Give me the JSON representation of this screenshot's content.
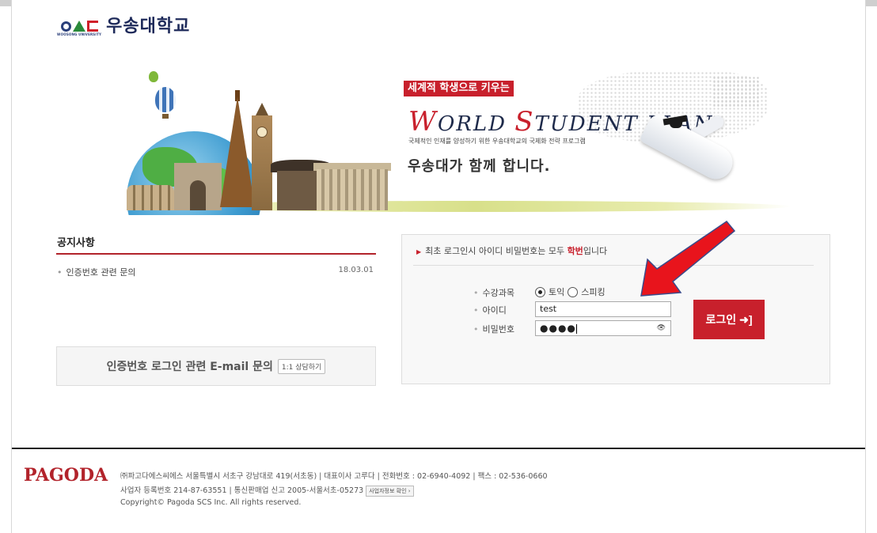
{
  "logo": {
    "text": "우송대학교",
    "sub": "WOOSONG UNIVERSITY"
  },
  "banner": {
    "slogan": "세계적 학생으로 키우는",
    "title_parts": [
      "W",
      "ORLD ",
      "S",
      "TUDENT ",
      "PLAN"
    ],
    "subtitle": "국제적인 인재를 양성하기 위한 우송대학교의 국제화 전략 프로그램",
    "together": "우송대가 함께 합니다."
  },
  "notice": {
    "title": "공지사항",
    "items": [
      {
        "label": "인증번호 관련 문의",
        "date": "18.03.01"
      }
    ]
  },
  "inquiry": {
    "text": "인증번호 로그인 관련 E-mail 문의",
    "button": "1:1 상담하기"
  },
  "login": {
    "notice_prefix": "최초 로그인시 아이디 비밀번호는 모두 ",
    "notice_emph": "학번",
    "notice_suffix": "입니다",
    "course_label": "수강과목",
    "course_options": [
      "토익",
      "스피킹"
    ],
    "id_label": "아이디",
    "id_value": "test",
    "pw_label": "비밀번호",
    "pw_value": "●●●●",
    "button": "로그인"
  },
  "footer": {
    "brand": "PAGODA",
    "line1": "㈜파고다에스씨에스 서울특별시 서초구 강남대로 419(서초동)  |  대표이사 고루다  |  전화번호 : 02-6940-4092  |  팩스 : 02-536-0660",
    "line2": "사업자 등록번호 214-87-63551  |  통신판매업 신고 2005-서울서초-05273",
    "line2_button": "사업자정보 확인 ›",
    "line3": "Copyright© Pagoda SCS Inc. All rights reserved."
  },
  "colors": {
    "accent": "#c8202c",
    "arrow": "#e8141c",
    "navy": "#1e2a5a"
  },
  "icons": {
    "eye": "eye-icon",
    "login": "login-arrow-icon"
  }
}
